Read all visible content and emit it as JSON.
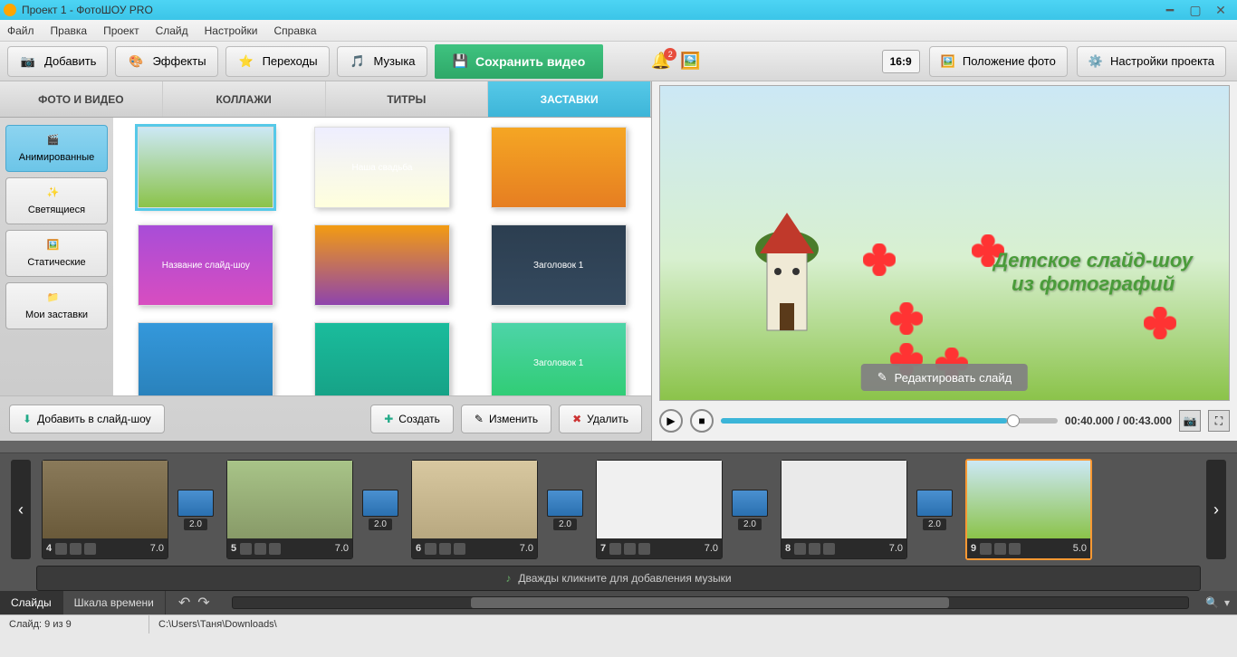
{
  "title": "Проект 1 - ФотоШОУ PRO",
  "menu": [
    "Файл",
    "Правка",
    "Проект",
    "Слайд",
    "Настройки",
    "Справка"
  ],
  "toolbar": {
    "add": "Добавить",
    "effects": "Эффекты",
    "transitions": "Переходы",
    "music": "Музыка",
    "save_video": "Сохранить видео",
    "notif_count": "2",
    "aspect": "16:9",
    "photo_position": "Положение фото",
    "project_settings": "Настройки проекта"
  },
  "left_tabs": [
    "ФОТО И ВИДЕО",
    "КОЛЛАЖИ",
    "ТИТРЫ",
    "ЗАСТАВКИ"
  ],
  "categories": [
    {
      "label": "Анимированные",
      "selected": true
    },
    {
      "label": "Светящиеся",
      "selected": false
    },
    {
      "label": "Статические",
      "selected": false
    },
    {
      "label": "Мои заставки",
      "selected": false
    }
  ],
  "templates": [
    {
      "label": "",
      "selected": true,
      "bg": "linear-gradient(#cce8f5,#8bc34a)"
    },
    {
      "label": "Наша свадьба",
      "bg": "linear-gradient(#eef,#ffd)"
    },
    {
      "label": "",
      "bg": "linear-gradient(#f5a623,#e67e22)"
    },
    {
      "label": "Название слайд-шоу",
      "bg": "linear-gradient(#a84dd8,#d84dc0)"
    },
    {
      "label": "",
      "bg": "linear-gradient(#f39c12,#8e44ad)"
    },
    {
      "label": "Заголовок 1",
      "bg": "linear-gradient(#2c3e50,#34495e)"
    },
    {
      "label": "",
      "bg": "linear-gradient(#3498db,#2980b9)"
    },
    {
      "label": "",
      "bg": "linear-gradient(#1abc9c,#16a085)"
    },
    {
      "label": "Заголовок 1",
      "bg": "linear-gradient(#4dd4a8,#2ecc71)"
    }
  ],
  "left_actions": {
    "add_slideshow": "Добавить в слайд-шоу",
    "create": "Создать",
    "edit": "Изменить",
    "delete": "Удалить"
  },
  "preview": {
    "text_line1": "Детское слайд-шоу",
    "text_line2": "из фотографий",
    "edit_button": "Редактировать слайд",
    "time": "00:40.000 / 00:43.000"
  },
  "timeline": {
    "slides": [
      {
        "num": "4",
        "dur": "7.0",
        "trans": "2.0"
      },
      {
        "num": "5",
        "dur": "7.0",
        "trans": "2.0"
      },
      {
        "num": "6",
        "dur": "7.0",
        "trans": "2.0"
      },
      {
        "num": "7",
        "dur": "7.0",
        "trans": "2.0"
      },
      {
        "num": "8",
        "dur": "7.0",
        "trans": "2.0"
      },
      {
        "num": "9",
        "dur": "5.0",
        "trans": "",
        "selected": true
      }
    ],
    "music_hint": "Дважды кликните для добавления музыки"
  },
  "bottom": {
    "slides_tab": "Слайды",
    "timeline_tab": "Шкала времени"
  },
  "status": {
    "slide_info": "Слайд: 9 из 9",
    "path": "C:\\Users\\Таня\\Downloads\\"
  }
}
